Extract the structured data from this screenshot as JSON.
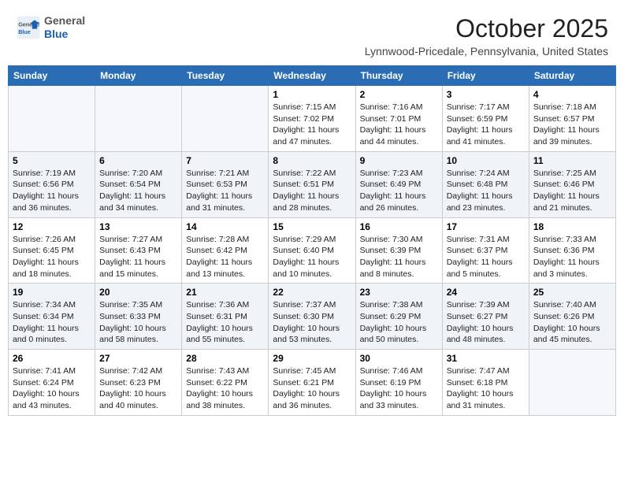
{
  "header": {
    "logo_line1": "General",
    "logo_line2": "Blue",
    "month": "October 2025",
    "location": "Lynnwood-Pricedale, Pennsylvania, United States"
  },
  "weekdays": [
    "Sunday",
    "Monday",
    "Tuesday",
    "Wednesday",
    "Thursday",
    "Friday",
    "Saturday"
  ],
  "weeks": [
    [
      {
        "day": "",
        "info": ""
      },
      {
        "day": "",
        "info": ""
      },
      {
        "day": "",
        "info": ""
      },
      {
        "day": "1",
        "info": "Sunrise: 7:15 AM\nSunset: 7:02 PM\nDaylight: 11 hours and 47 minutes."
      },
      {
        "day": "2",
        "info": "Sunrise: 7:16 AM\nSunset: 7:01 PM\nDaylight: 11 hours and 44 minutes."
      },
      {
        "day": "3",
        "info": "Sunrise: 7:17 AM\nSunset: 6:59 PM\nDaylight: 11 hours and 41 minutes."
      },
      {
        "day": "4",
        "info": "Sunrise: 7:18 AM\nSunset: 6:57 PM\nDaylight: 11 hours and 39 minutes."
      }
    ],
    [
      {
        "day": "5",
        "info": "Sunrise: 7:19 AM\nSunset: 6:56 PM\nDaylight: 11 hours and 36 minutes."
      },
      {
        "day": "6",
        "info": "Sunrise: 7:20 AM\nSunset: 6:54 PM\nDaylight: 11 hours and 34 minutes."
      },
      {
        "day": "7",
        "info": "Sunrise: 7:21 AM\nSunset: 6:53 PM\nDaylight: 11 hours and 31 minutes."
      },
      {
        "day": "8",
        "info": "Sunrise: 7:22 AM\nSunset: 6:51 PM\nDaylight: 11 hours and 28 minutes."
      },
      {
        "day": "9",
        "info": "Sunrise: 7:23 AM\nSunset: 6:49 PM\nDaylight: 11 hours and 26 minutes."
      },
      {
        "day": "10",
        "info": "Sunrise: 7:24 AM\nSunset: 6:48 PM\nDaylight: 11 hours and 23 minutes."
      },
      {
        "day": "11",
        "info": "Sunrise: 7:25 AM\nSunset: 6:46 PM\nDaylight: 11 hours and 21 minutes."
      }
    ],
    [
      {
        "day": "12",
        "info": "Sunrise: 7:26 AM\nSunset: 6:45 PM\nDaylight: 11 hours and 18 minutes."
      },
      {
        "day": "13",
        "info": "Sunrise: 7:27 AM\nSunset: 6:43 PM\nDaylight: 11 hours and 15 minutes."
      },
      {
        "day": "14",
        "info": "Sunrise: 7:28 AM\nSunset: 6:42 PM\nDaylight: 11 hours and 13 minutes."
      },
      {
        "day": "15",
        "info": "Sunrise: 7:29 AM\nSunset: 6:40 PM\nDaylight: 11 hours and 10 minutes."
      },
      {
        "day": "16",
        "info": "Sunrise: 7:30 AM\nSunset: 6:39 PM\nDaylight: 11 hours and 8 minutes."
      },
      {
        "day": "17",
        "info": "Sunrise: 7:31 AM\nSunset: 6:37 PM\nDaylight: 11 hours and 5 minutes."
      },
      {
        "day": "18",
        "info": "Sunrise: 7:33 AM\nSunset: 6:36 PM\nDaylight: 11 hours and 3 minutes."
      }
    ],
    [
      {
        "day": "19",
        "info": "Sunrise: 7:34 AM\nSunset: 6:34 PM\nDaylight: 11 hours and 0 minutes."
      },
      {
        "day": "20",
        "info": "Sunrise: 7:35 AM\nSunset: 6:33 PM\nDaylight: 10 hours and 58 minutes."
      },
      {
        "day": "21",
        "info": "Sunrise: 7:36 AM\nSunset: 6:31 PM\nDaylight: 10 hours and 55 minutes."
      },
      {
        "day": "22",
        "info": "Sunrise: 7:37 AM\nSunset: 6:30 PM\nDaylight: 10 hours and 53 minutes."
      },
      {
        "day": "23",
        "info": "Sunrise: 7:38 AM\nSunset: 6:29 PM\nDaylight: 10 hours and 50 minutes."
      },
      {
        "day": "24",
        "info": "Sunrise: 7:39 AM\nSunset: 6:27 PM\nDaylight: 10 hours and 48 minutes."
      },
      {
        "day": "25",
        "info": "Sunrise: 7:40 AM\nSunset: 6:26 PM\nDaylight: 10 hours and 45 minutes."
      }
    ],
    [
      {
        "day": "26",
        "info": "Sunrise: 7:41 AM\nSunset: 6:24 PM\nDaylight: 10 hours and 43 minutes."
      },
      {
        "day": "27",
        "info": "Sunrise: 7:42 AM\nSunset: 6:23 PM\nDaylight: 10 hours and 40 minutes."
      },
      {
        "day": "28",
        "info": "Sunrise: 7:43 AM\nSunset: 6:22 PM\nDaylight: 10 hours and 38 minutes."
      },
      {
        "day": "29",
        "info": "Sunrise: 7:45 AM\nSunset: 6:21 PM\nDaylight: 10 hours and 36 minutes."
      },
      {
        "day": "30",
        "info": "Sunrise: 7:46 AM\nSunset: 6:19 PM\nDaylight: 10 hours and 33 minutes."
      },
      {
        "day": "31",
        "info": "Sunrise: 7:47 AM\nSunset: 6:18 PM\nDaylight: 10 hours and 31 minutes."
      },
      {
        "day": "",
        "info": ""
      }
    ]
  ]
}
